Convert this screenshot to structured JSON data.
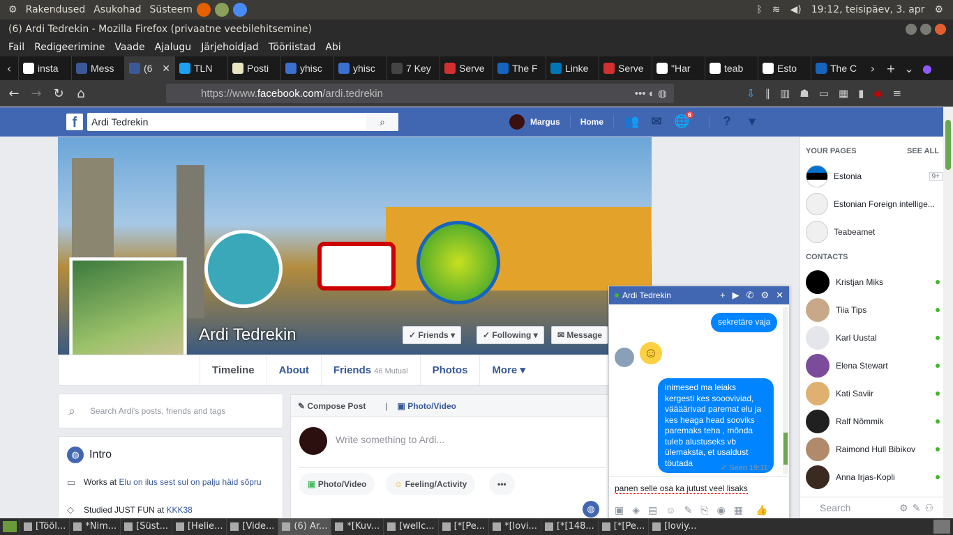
{
  "os_bar": {
    "menus": [
      "Rakendused",
      "Asukohad",
      "Süsteem"
    ],
    "clock": "19:12, teisipäev, 3. apr"
  },
  "window": {
    "title": "(6) Ardi Tedrekin - Mozilla Firefox (privaatne veebilehitsemine)"
  },
  "menubar": [
    "Fail",
    "Redigeerimine",
    "Vaade",
    "Ajalugu",
    "Järjehoidjad",
    "Tööriistad",
    "Abi"
  ],
  "tabs": [
    {
      "label": "insta",
      "color": "#ffffff"
    },
    {
      "label": "Mess",
      "color": "#3b5998"
    },
    {
      "label": "(6",
      "color": "#3b5998"
    },
    {
      "label": "TLN",
      "color": "#1da1f2"
    },
    {
      "label": "Posti",
      "color": "#e8e3c0"
    },
    {
      "label": "yhisc",
      "color": "#3b6fd0"
    },
    {
      "label": "yhisc",
      "color": "#3b6fd0"
    },
    {
      "label": "7 Key",
      "color": "#444444"
    },
    {
      "label": "Serve",
      "color": "#d32f2f"
    },
    {
      "label": "The F",
      "color": "#1565c0"
    },
    {
      "label": "Linke",
      "color": "#0077b5"
    },
    {
      "label": "Serve",
      "color": "#d32f2f"
    },
    {
      "label": "\"Har",
      "color": "#ffffff"
    },
    {
      "label": "teab",
      "color": "#ffffff"
    },
    {
      "label": "Esto",
      "color": "#ffffff"
    },
    {
      "label": "The C",
      "color": "#1565c0"
    }
  ],
  "url": {
    "prefix": "https://www.",
    "domain": "facebook.com",
    "path": "/ardi.tedrekin"
  },
  "fb": {
    "search_value": "Ardi Tedrekin",
    "user_name": "Margus",
    "home": "Home",
    "notif_count": "6"
  },
  "profile": {
    "name": "Ardi Tedrekin",
    "friends_btn": "Friends",
    "following_btn": "Following",
    "message_btn": "Message",
    "tabs": {
      "timeline": "Timeline",
      "about": "About",
      "friends": "Friends",
      "mutual": "46 Mutual",
      "photos": "Photos",
      "more": "More"
    },
    "search_placeholder": "Search Ardi's posts, friends and tags",
    "intro_title": "Intro",
    "works_prefix": "Works at ",
    "works_link": "Elu on ilus sest sul on palju häid sõpru",
    "studied_prefix": "Studied JUST FUN at ",
    "studied_link": "KKK38"
  },
  "compose": {
    "compose_post": "Compose Post",
    "photo_video": "Photo/Video",
    "placeholder": "Write something to Ardi...",
    "btn_photo": "Photo/Video",
    "btn_feeling": "Feeling/Activity"
  },
  "chat": {
    "name": "Ardi Tedrekin",
    "msg_top": "sekretäre vaja",
    "msg_long": "inimesed ma leiaks kergesti kes soooviviad, väääärivad paremat elu ja kes heaga head sooviks paremaks teha , mõnda tuleb alustuseks vb ülemaksta, et usaldust töutada",
    "seen": "✓ Seen 19:11",
    "input": "panen selle osa ka jutust veel lisaks"
  },
  "sidebar": {
    "your_pages": "YOUR PAGES",
    "see_all": "SEE ALL",
    "pages": [
      {
        "name": "Estonia",
        "count": "9+"
      },
      {
        "name": "Estonian Foreign intellige...",
        "count": ""
      },
      {
        "name": "Teabeamet",
        "count": ""
      }
    ],
    "contacts_title": "CONTACTS",
    "contacts": [
      {
        "name": "Kristjan Miks",
        "color": "#000000"
      },
      {
        "name": "Tiia Tips",
        "color": "#c9a88a"
      },
      {
        "name": "Karl Uustal",
        "color": "#e4e6eb"
      },
      {
        "name": "Elena Stewart",
        "color": "#7a4c9a"
      },
      {
        "name": "Kati Saviir",
        "color": "#e0b070"
      },
      {
        "name": "Ralf Nõmmik",
        "color": "#202020"
      },
      {
        "name": "Raimond Hull Bibikov",
        "color": "#b08a6a"
      },
      {
        "name": "Anna Irjas-Kopli",
        "color": "#3a2a20"
      }
    ],
    "search": "Search"
  },
  "taskbar": [
    "[Tööl...",
    "*Nim...",
    "[Süst...",
    "[Helie...",
    "[Vide...",
    "(6) Ar...",
    "*[Kuv...",
    "[wellc...",
    "[*[Pe...",
    "*[lovi...",
    "[*[148...",
    "[*[Pe...",
    "[loviy..."
  ]
}
